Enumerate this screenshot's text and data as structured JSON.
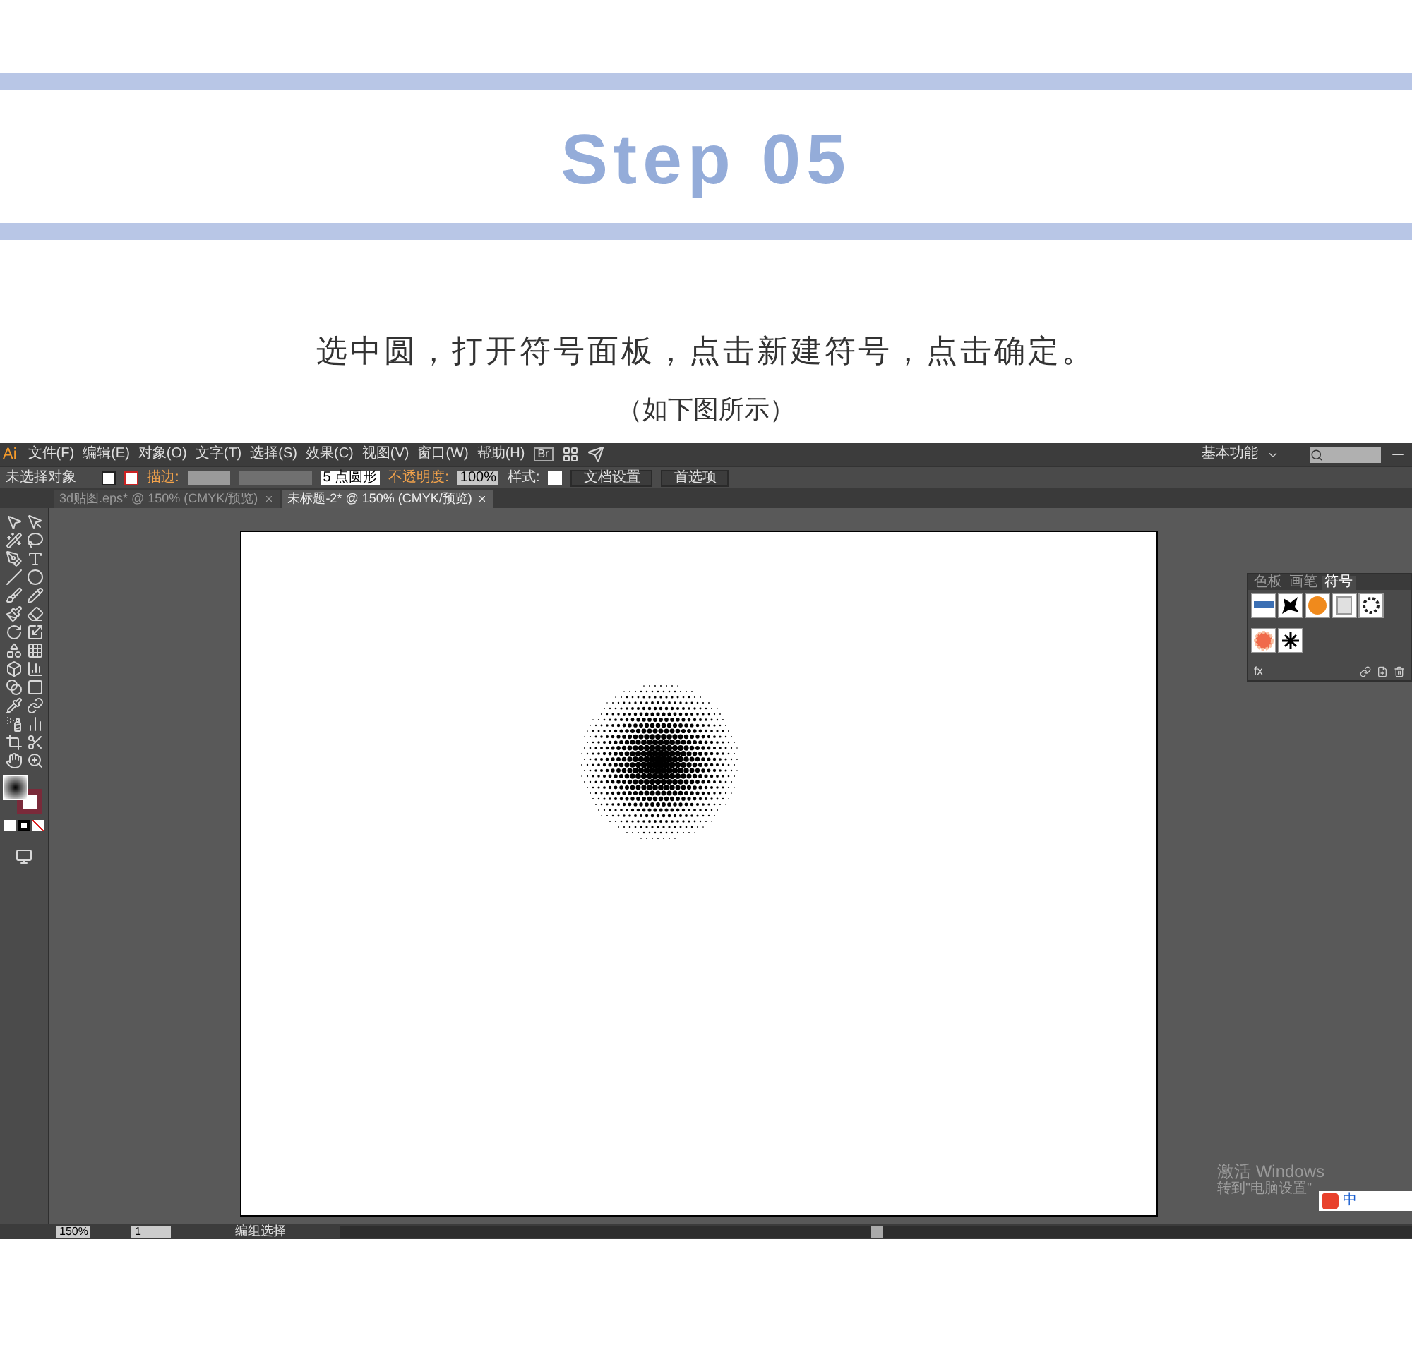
{
  "header": {
    "title": "Step 05",
    "instruction": "选中圆，打开符号面板，点击新建符号，点击确定。",
    "note": "（如下图所示）"
  },
  "app": {
    "logo": "Ai",
    "menu": [
      "文件(F)",
      "编辑(E)",
      "对象(O)",
      "文字(T)",
      "选择(S)",
      "效果(C)",
      "视图(V)",
      "窗口(W)",
      "帮助(H)"
    ],
    "bridge": "Br",
    "workspace": "基本功能",
    "options": {
      "selection": "未选择对象",
      "stroke_label": "描边:",
      "brush": "5 点圆形",
      "opacity_label": "不透明度:",
      "opacity": "100%",
      "style_label": "样式:",
      "doc_setup": "文档设置",
      "prefs": "首选项"
    },
    "tabs": [
      {
        "label": "3d贴图.eps* @ 150% (CMYK/预览)",
        "selected": false
      },
      {
        "label": "未标题-2* @ 150% (CMYK/预览)",
        "selected": true
      }
    ],
    "panel": {
      "tabs": [
        {
          "label": "色板",
          "selected": false
        },
        {
          "label": "画笔",
          "selected": false
        },
        {
          "label": "符号",
          "selected": true
        }
      ],
      "footer": "fx"
    },
    "status": {
      "zoom": "150%",
      "page": "1",
      "tool": "编组选择"
    },
    "activation": {
      "title": "激活 Windows",
      "hint": "转到\"电脑设置\""
    },
    "ime": {
      "mode": "中"
    }
  }
}
